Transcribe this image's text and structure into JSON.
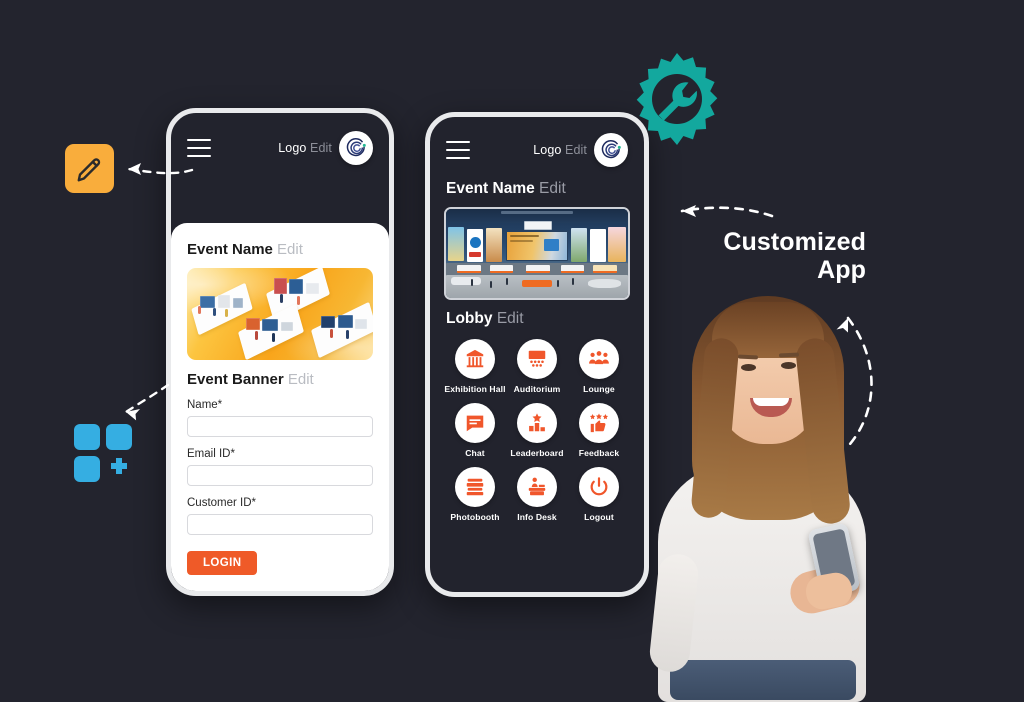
{
  "theme": {
    "background": "#23242e",
    "accent_orange": "#ef5a28",
    "accent_teal": "#13a89e",
    "accent_amber": "#f9ad3c",
    "accent_blue": "#35aee2",
    "phone_frame": "#e9eaec",
    "muted_text": "#9a9ca6"
  },
  "phone1": {
    "name": "login-screen-phone",
    "topbar": {
      "menu_icon": "hamburger-menu-icon",
      "logo_label": "Logo",
      "logo_edit_label": "Edit",
      "logo_icon": "brand-swirl-logo-icon"
    },
    "event_title": "Event Name",
    "event_title_edit": "Edit",
    "banner_alt": "isometric-exhibition-booths-illustration",
    "banner_title": "Event Banner",
    "banner_title_edit": "Edit",
    "form": {
      "fields": [
        {
          "label": "Name*",
          "value": "",
          "placeholder": ""
        },
        {
          "label": "Email ID*",
          "value": "",
          "placeholder": ""
        },
        {
          "label": "Customer ID*",
          "value": "",
          "placeholder": ""
        }
      ],
      "submit_label": "LOGIN"
    }
  },
  "phone2": {
    "name": "lobby-screen-phone",
    "topbar": {
      "menu_icon": "hamburger-menu-icon",
      "logo_label": "Logo",
      "logo_edit_label": "Edit",
      "logo_icon": "brand-swirl-logo-icon"
    },
    "event_title": "Event Name",
    "event_title_edit": "Edit",
    "lobby_image_alt": "virtual-event-lobby-3d-render",
    "lobby_title": "Lobby",
    "lobby_title_edit": "Edit",
    "menu_items": [
      {
        "label": "Exhibition Hall",
        "icon": "exhibition-hall-icon"
      },
      {
        "label": "Auditorium",
        "icon": "auditorium-icon"
      },
      {
        "label": "Lounge",
        "icon": "lounge-people-icon"
      },
      {
        "label": "Chat",
        "icon": "chat-bubble-icon"
      },
      {
        "label": "Leaderboard",
        "icon": "leaderboard-podium-icon"
      },
      {
        "label": "Feedback",
        "icon": "feedback-thumbsup-icon"
      },
      {
        "label": "Photobooth",
        "icon": "photobooth-camera-icon"
      },
      {
        "label": "Info Desk",
        "icon": "info-desk-icon"
      },
      {
        "label": "Logout",
        "icon": "power-logout-icon"
      }
    ]
  },
  "decorations": {
    "pencil_badge": "edit-pencil-badge-icon",
    "blocks_badge": "add-module-blocks-icon",
    "gear_badge": "gear-wrench-settings-icon",
    "arrow_to_phone1": "dashed-arrow-icon",
    "arrow_to_blocks": "dashed-arrow-icon",
    "arrow_to_phone2": "dashed-arrow-icon",
    "arrow_curved_down": "curved-dashed-arrow-icon",
    "person_photo": "smiling-woman-holding-phone-photo"
  },
  "caption": {
    "line1": "Customized",
    "line2": "App"
  }
}
